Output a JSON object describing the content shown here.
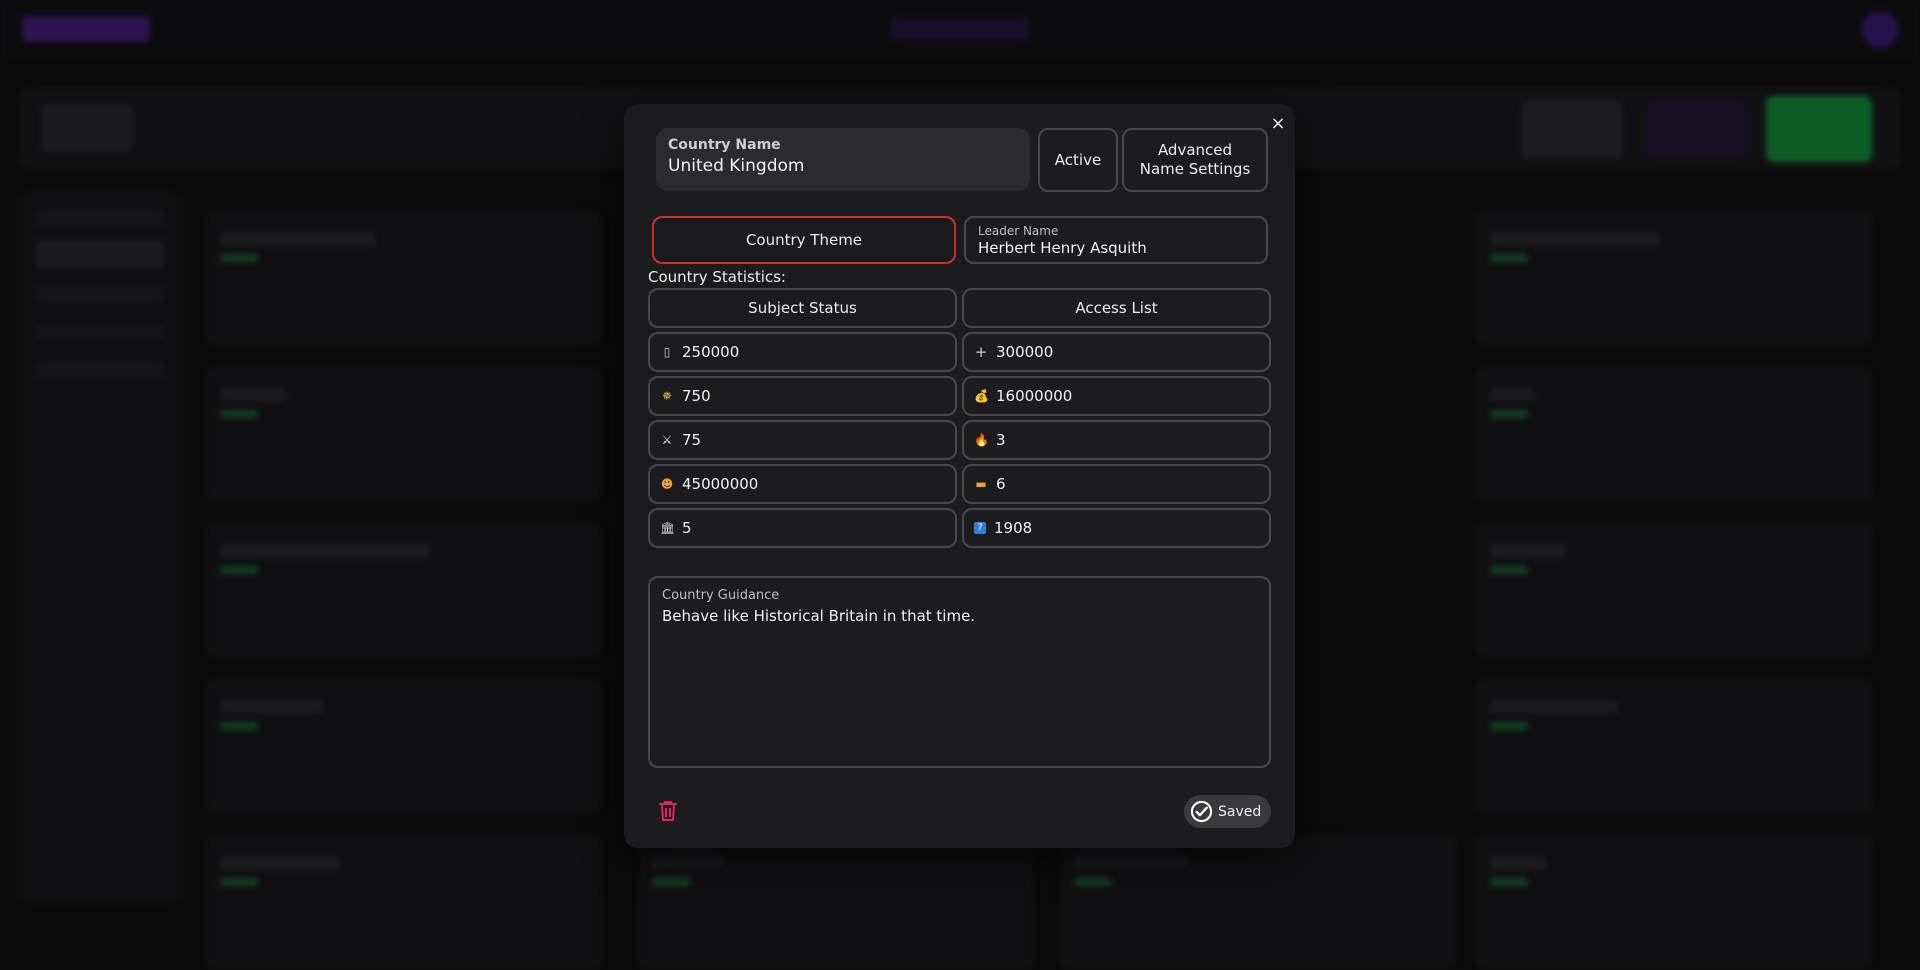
{
  "modal": {
    "country_name": {
      "label": "Country Name",
      "value": "United Kingdom"
    },
    "active_label": "Active",
    "advanced_label_line1": "Advanced",
    "advanced_label_line2": "Name Settings",
    "theme_label": "Country Theme",
    "leader": {
      "label": "Leader Name",
      "value": "Herbert Henry Asquith"
    },
    "stats_title": "Country Statistics:",
    "subject_status_label": "Subject Status",
    "access_list_label": "Access List",
    "stats": [
      {
        "icon": "flag-icon",
        "glyph": "▯",
        "value": "250000"
      },
      {
        "icon": "plus-icon",
        "glyph": "+",
        "value": "300000"
      },
      {
        "icon": "star-icon",
        "glyph": "✵",
        "value": "750"
      },
      {
        "icon": "money-bag-icon",
        "glyph": "💰",
        "value": "16000000"
      },
      {
        "icon": "crossed-swords-icon",
        "glyph": "⚔",
        "value": "75"
      },
      {
        "icon": "fire-icon",
        "glyph": "🔥",
        "value": "3"
      },
      {
        "icon": "person-icon",
        "glyph": "☻",
        "value": "45000000"
      },
      {
        "icon": "card-icon",
        "glyph": "▬",
        "value": "6"
      },
      {
        "icon": "bank-icon",
        "glyph": "🏛",
        "value": "5"
      },
      {
        "icon": "calendar-icon",
        "glyph": "7",
        "value": "1908"
      }
    ],
    "guidance": {
      "label": "Country Guidance",
      "value": "Behave like Historical Britain in that time."
    },
    "saved_label": "Saved",
    "close_glyph": "×"
  },
  "colors": {
    "accent_red": "#c8322a",
    "delete_pink": "#e0245e",
    "brand_purple": "#4b1d8c",
    "create_green": "#12a23f"
  }
}
